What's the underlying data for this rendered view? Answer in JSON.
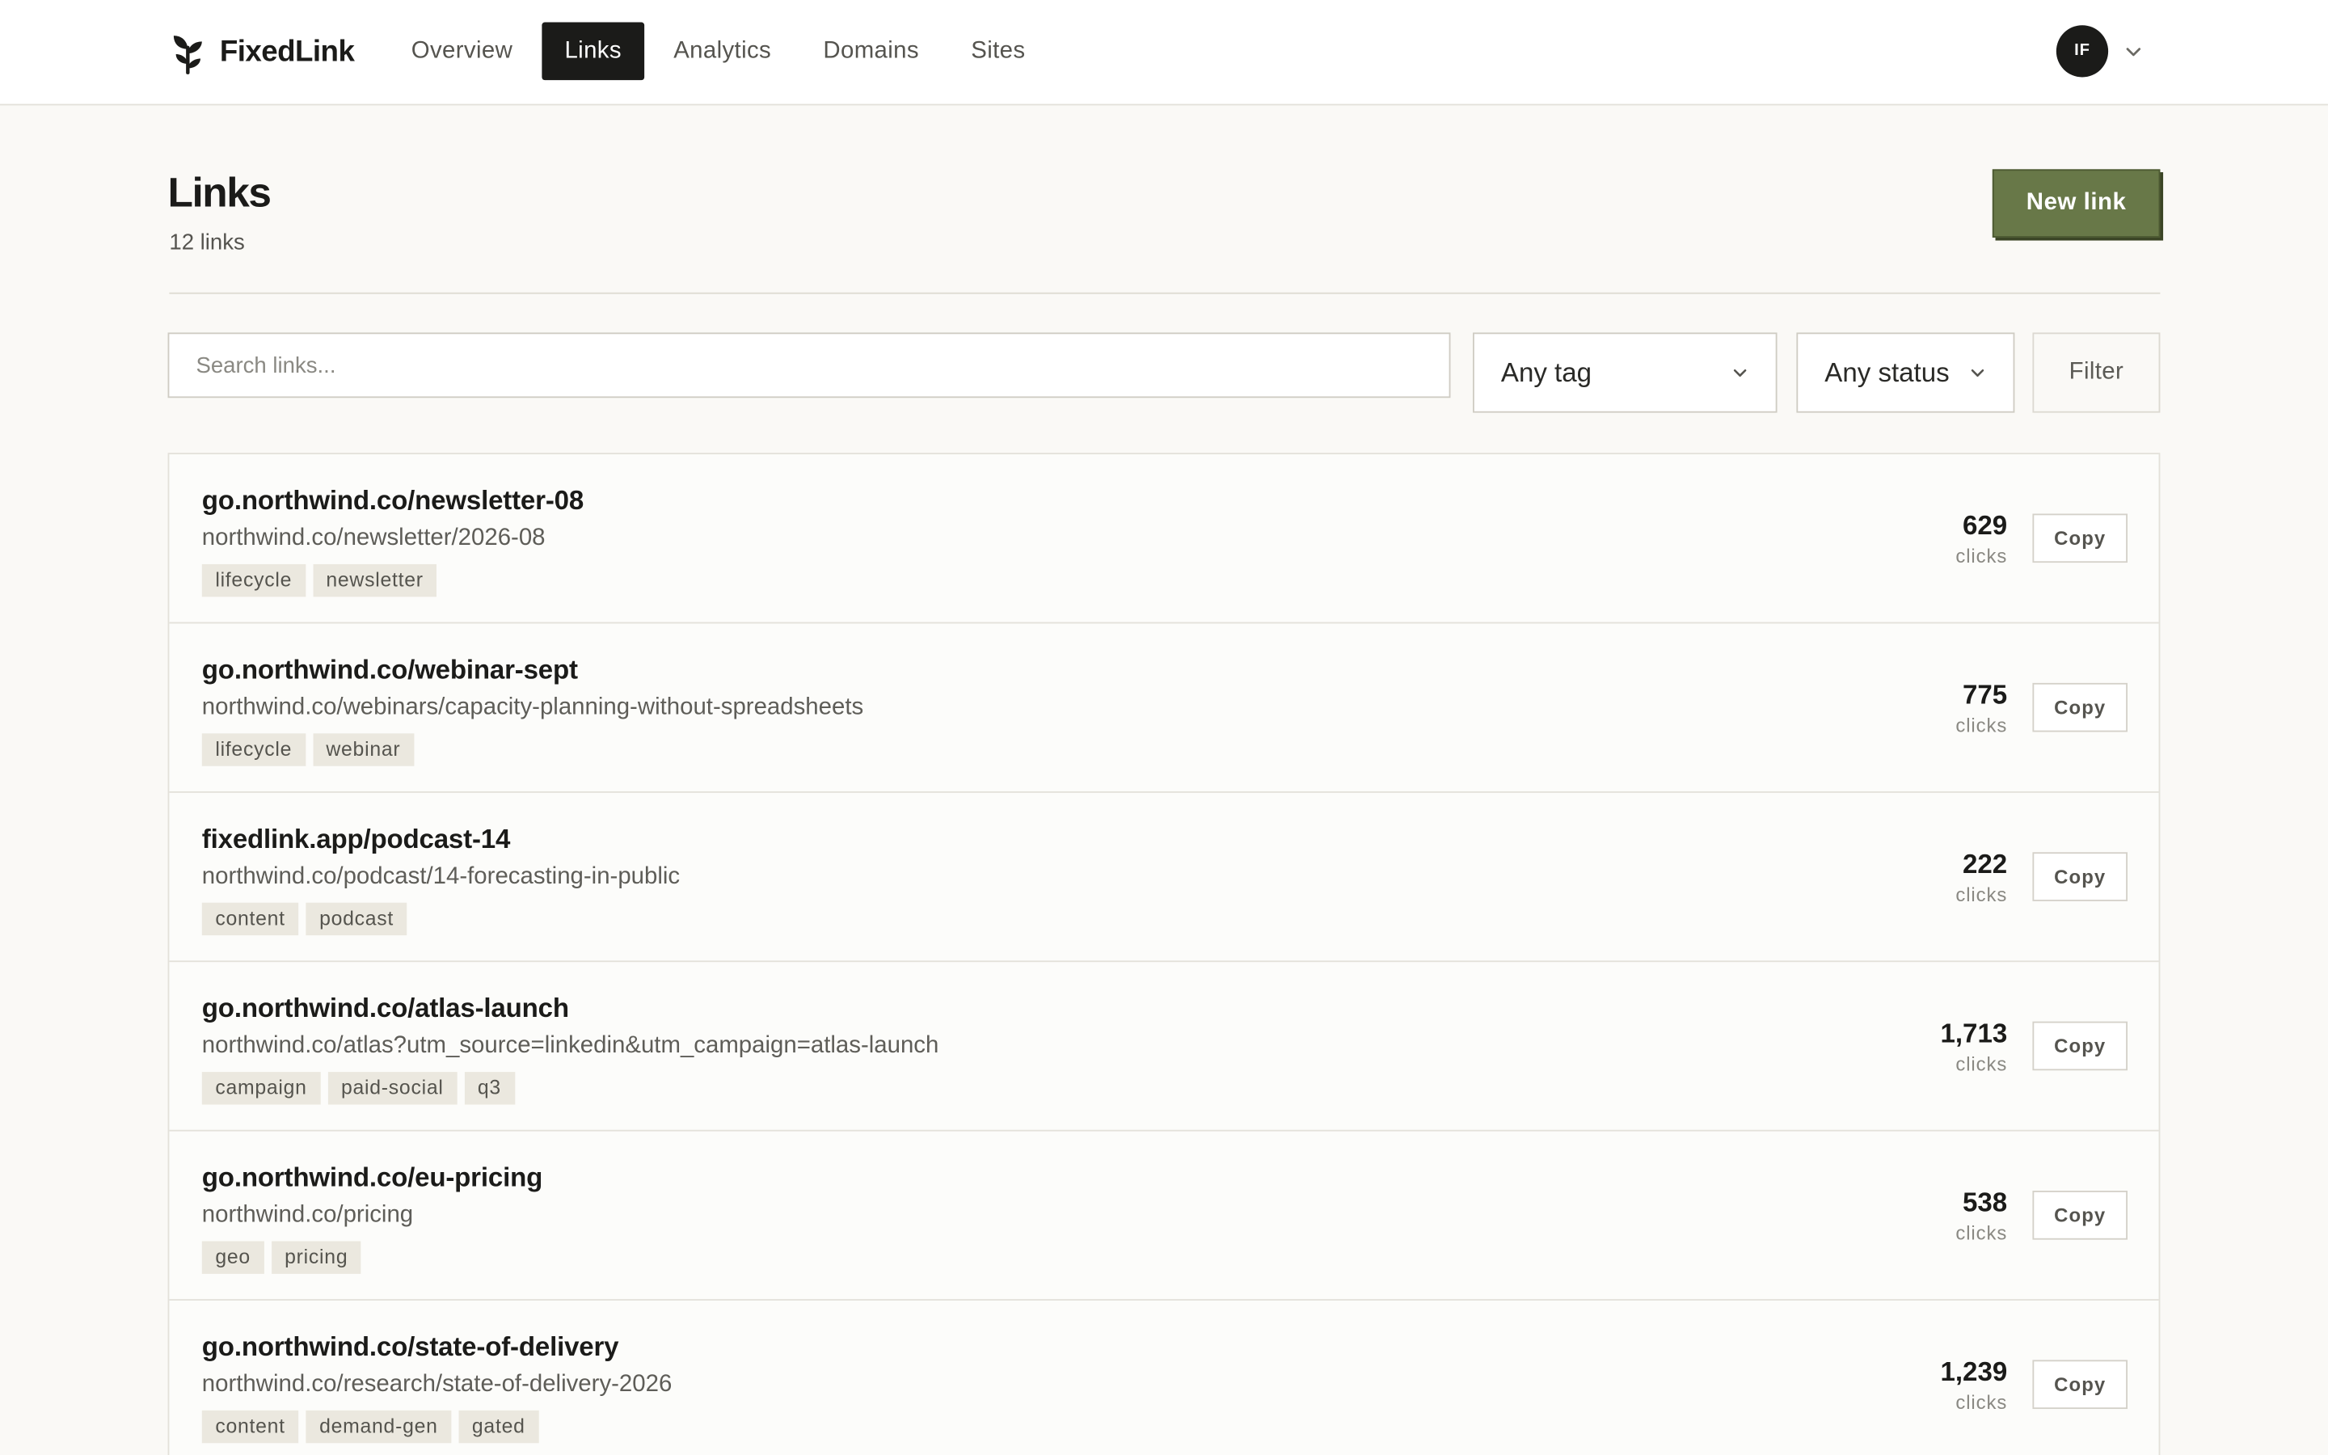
{
  "app": {
    "name": "FixedLink"
  },
  "nav": {
    "items": [
      {
        "label": "Overview"
      },
      {
        "label": "Links"
      },
      {
        "label": "Analytics"
      },
      {
        "label": "Domains"
      },
      {
        "label": "Sites"
      }
    ],
    "active": "Links"
  },
  "user": {
    "initials": "IF"
  },
  "header": {
    "title": "Links",
    "subtitle": "12 links",
    "new_button": "New link"
  },
  "filters": {
    "search_placeholder": "Search links...",
    "search_value": "",
    "tag_select": "Any tag",
    "status_select": "Any status",
    "filter_button": "Filter"
  },
  "colors": {
    "accent": "#687848",
    "nav_active": "#1b1b19",
    "background": "#faf9f6"
  },
  "links": [
    {
      "short": "go.northwind.co/newsletter-08",
      "destination": "northwind.co/newsletter/2026-08",
      "tags": [
        "lifecycle",
        "newsletter"
      ],
      "clicks": "629",
      "clicks_label": "clicks",
      "copy": "Copy"
    },
    {
      "short": "go.northwind.co/webinar-sept",
      "destination": "northwind.co/webinars/capacity-planning-without-spreadsheets",
      "tags": [
        "lifecycle",
        "webinar"
      ],
      "clicks": "775",
      "clicks_label": "clicks",
      "copy": "Copy"
    },
    {
      "short": "fixedlink.app/podcast-14",
      "destination": "northwind.co/podcast/14-forecasting-in-public",
      "tags": [
        "content",
        "podcast"
      ],
      "clicks": "222",
      "clicks_label": "clicks",
      "copy": "Copy"
    },
    {
      "short": "go.northwind.co/atlas-launch",
      "destination": "northwind.co/atlas?utm_source=linkedin&utm_campaign=atlas-launch",
      "tags": [
        "campaign",
        "paid-social",
        "q3"
      ],
      "clicks": "1,713",
      "clicks_label": "clicks",
      "copy": "Copy"
    },
    {
      "short": "go.northwind.co/eu-pricing",
      "destination": "northwind.co/pricing",
      "tags": [
        "geo",
        "pricing"
      ],
      "clicks": "538",
      "clicks_label": "clicks",
      "copy": "Copy"
    },
    {
      "short": "go.northwind.co/state-of-delivery",
      "destination": "northwind.co/research/state-of-delivery-2026",
      "tags": [
        "content",
        "demand-gen",
        "gated"
      ],
      "clicks": "1,239",
      "clicks_label": "clicks",
      "copy": "Copy"
    }
  ]
}
